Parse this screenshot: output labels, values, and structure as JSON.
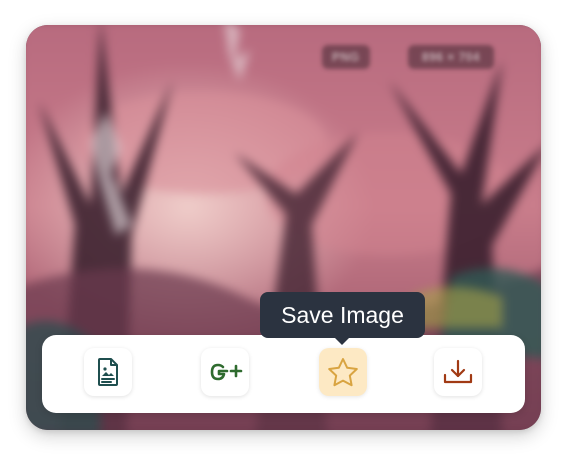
{
  "image": {
    "format_badge": "PNG",
    "dimensions_badge": "896 × 704"
  },
  "toolbar": {
    "buttons": [
      {
        "name": "document",
        "icon": "document-icon",
        "color": "#1f4f4f"
      },
      {
        "name": "google-plus",
        "icon": "google-plus-icon",
        "color": "#2f6b2f"
      },
      {
        "name": "save-image",
        "icon": "star-icon",
        "color": "#d9a441",
        "active": true
      },
      {
        "name": "download",
        "icon": "download-icon",
        "color": "#a13a14"
      }
    ]
  },
  "tooltip": {
    "text": "Save Image"
  }
}
